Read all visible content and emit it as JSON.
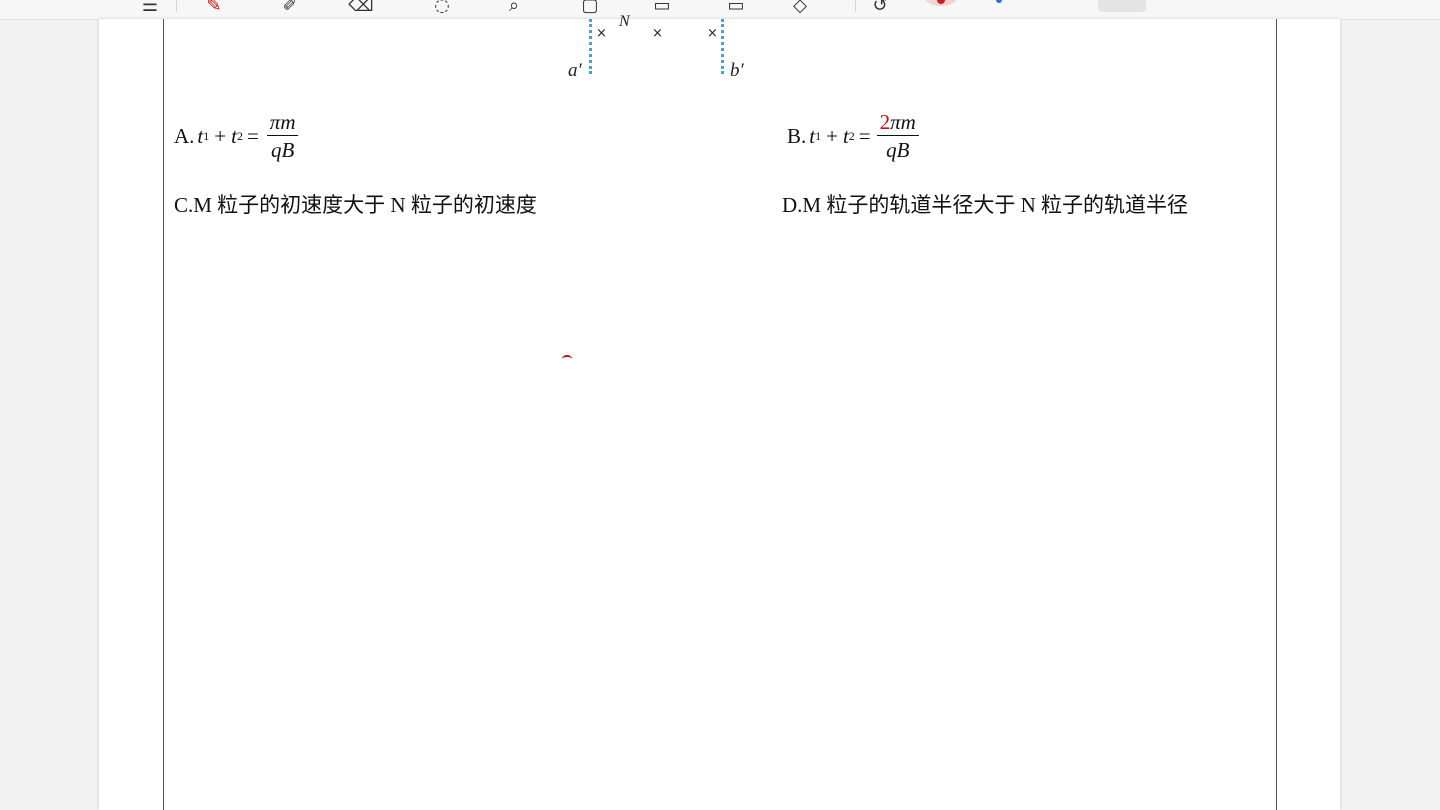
{
  "toolbar": {
    "icons": [
      "menu-icon",
      "pen-icon",
      "highlighter-icon",
      "eraser-icon",
      "lasso-icon",
      "search-icon",
      "shape-icon",
      "text-icon",
      "image-icon",
      "tag-icon",
      "undo-icon",
      "red-color",
      "blue-color",
      "more"
    ]
  },
  "figure": {
    "label_a": "a′",
    "label_b": "b′",
    "label_N": "N",
    "cross": "×"
  },
  "options": {
    "A": {
      "prefix": "A.",
      "t1": "t",
      "t2": "t",
      "sub1": "1",
      "sub2": "2",
      "plus": "+",
      "eq": "=",
      "num": "πm",
      "den": "qB"
    },
    "B": {
      "prefix": "B.",
      "t1": "t",
      "t2": "t",
      "sub1": "1",
      "sub2": "2",
      "plus": "+",
      "eq": "=",
      "handwritten": "2",
      "num": "πm",
      "den": "qB"
    },
    "C": "C.M 粒子的初速度大于 N 粒子的初速度",
    "D": "D.M 粒子的轨道半径大于 N 粒子的轨道半径"
  },
  "colors": {
    "ink": "#c01010",
    "boundary": "#38a6d8"
  }
}
